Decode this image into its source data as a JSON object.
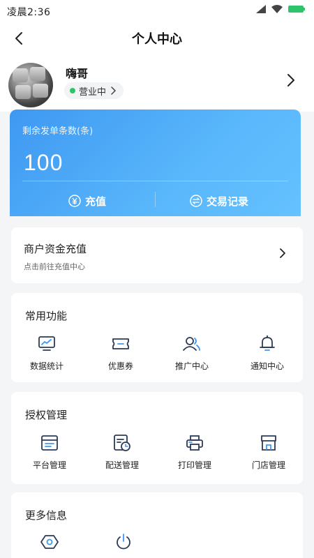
{
  "status_bar": {
    "time": "凌晨2:36"
  },
  "nav": {
    "title": "个人中心"
  },
  "profile": {
    "name": "嗨哥",
    "status": "营业中"
  },
  "balance": {
    "label": "剩余发单条数(条)",
    "value": "100",
    "recharge_label": "充值",
    "records_label": "交易记录"
  },
  "recharge_entry": {
    "title": "商户资金充值",
    "subtitle": "点击前往充值中心"
  },
  "common": {
    "title": "常用功能",
    "items": [
      {
        "label": "数据统计",
        "icon": "chart-icon"
      },
      {
        "label": "优惠券",
        "icon": "coupon-icon"
      },
      {
        "label": "推广中心",
        "icon": "users-icon"
      },
      {
        "label": "通知中心",
        "icon": "bell-icon"
      }
    ]
  },
  "auth": {
    "title": "授权管理",
    "items": [
      {
        "label": "平台管理",
        "icon": "platform-icon"
      },
      {
        "label": "配送管理",
        "icon": "delivery-schedule-icon"
      },
      {
        "label": "打印管理",
        "icon": "printer-icon"
      },
      {
        "label": "门店管理",
        "icon": "store-icon"
      }
    ]
  },
  "more": {
    "title": "更多信息",
    "items": [
      {
        "icon": "settings-icon"
      },
      {
        "icon": "power-icon"
      }
    ]
  },
  "colors": {
    "accent": "#3e98f2",
    "card_gradient_end": "#66c2ff",
    "status_dot": "#2ec46a",
    "icon": "#2b3a55"
  }
}
